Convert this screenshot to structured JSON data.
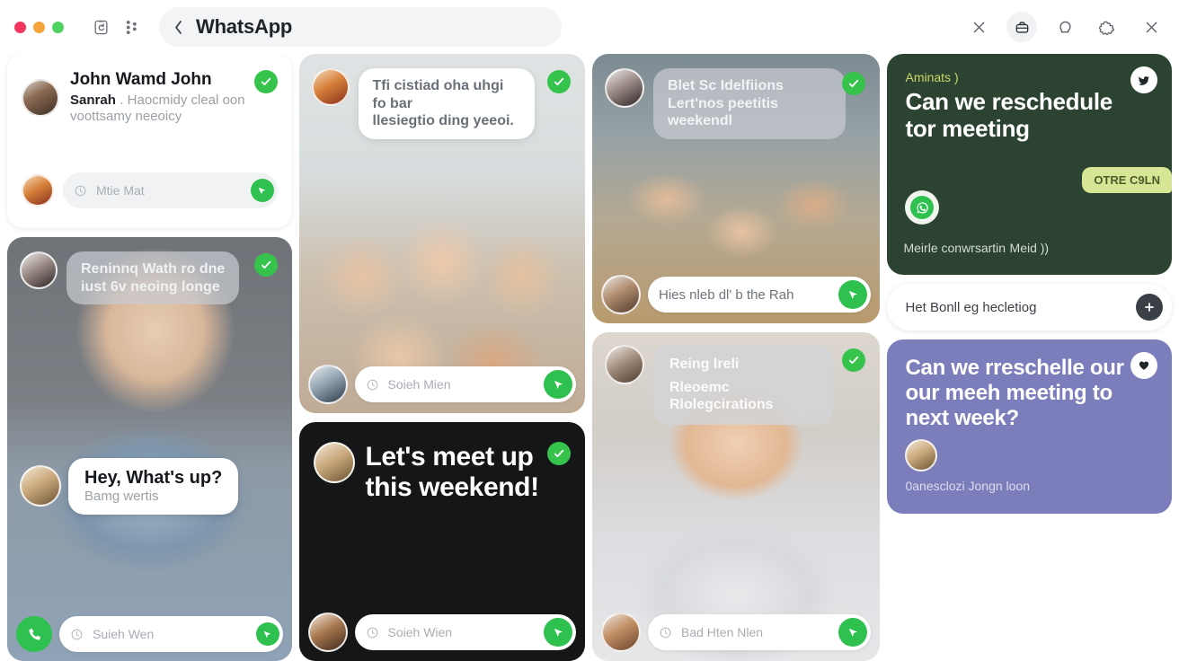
{
  "window": {
    "title": "WhatsApp",
    "back_chevron": "‹",
    "traffic_lights": [
      "close",
      "minimize",
      "maximize"
    ],
    "left_icons": [
      "clipboard-refresh-icon",
      "dots-grid-icon"
    ],
    "right_icons": [
      "close-icon",
      "briefcase-icon",
      "chat-bubble-icon",
      "puzzle-piece-icon",
      "close-icon"
    ],
    "colors": {
      "accent_green": "#2ec14f",
      "check_green": "#35c34c",
      "promo_green": "#2c4331",
      "promo_purple": "#7c7ebc",
      "chip_lime": "#d7e694"
    }
  },
  "column1": {
    "card_contact": {
      "name": "John Wamd John",
      "preview_strong": "Sanrah",
      "preview": ". Haocmidy cleal oon voottsamy neeoicy",
      "badge": "sent-check",
      "composer": {
        "placeholder": "Mtie Mat",
        "attach_icon": "clock-icon",
        "send_icon": "send-icon"
      }
    },
    "card_photo": {
      "bubble_line1": "Reninnq Wath ro dne",
      "bubble_line2": "iust 6v neoing longe",
      "badge": "sent-check",
      "quote_title": "Hey, What's up?",
      "quote_sub": "Bamg wertis",
      "call_icon": "phone-icon",
      "composer": {
        "placeholder": "Suieh Wen",
        "attach_icon": "clock-icon",
        "send_icon": "send-icon"
      }
    }
  },
  "column2": {
    "card_group": {
      "bubble_line1": "Tfi cistiad oha uhgi fo bar",
      "bubble_line2": "llesiegtio ding yeeoi.",
      "badge": "sent-check",
      "composer": {
        "placeholder": "Soieh Mien",
        "attach_icon": "clock-icon",
        "send_icon": "send-icon"
      }
    },
    "card_dark": {
      "headline_line1": "Let's meet up",
      "headline_line2": "this weekend!",
      "badge": "sent-check",
      "composer": {
        "placeholder": "Soieh Wien",
        "attach_icon": "clock-icon",
        "send_icon": "send-icon"
      }
    }
  },
  "column3": {
    "card_friends": {
      "bubble_line1": "Blet Sc Idelfiions",
      "bubble_line2": "Lert'nos peetitis weekendl",
      "badge": "sent-check",
      "composer": {
        "placeholder": "Hies nleb dl' b the Rah",
        "attach_icon": "clock-icon",
        "send_icon": "send-icon"
      }
    },
    "card_woman": {
      "bubble_line1": "Reing lreli",
      "bubble_line2": "Rleoemc Rlolegcirations",
      "badge": "sent-check",
      "composer": {
        "placeholder": "Bad Hten Nlen",
        "attach_icon": "clock-icon",
        "send_icon": "send-icon"
      }
    }
  },
  "column4": {
    "card_green": {
      "eyebrow": "Aminats )",
      "headline_line1": "Can we reschedule",
      "headline_line2": "tor meeting",
      "chip": "OTRE C9LN",
      "footer_text": "Meirle conwrsartin",
      "footer_accent": "Meid ))",
      "badge_icon": "bird-icon",
      "wa_icon": "whatsapp-icon"
    },
    "search_pill": {
      "text": "Het Bonll eg hecletiog",
      "button_icon": "plus-icon"
    },
    "card_purple": {
      "headline_line1": "Can we rreschelle our",
      "headline_line2": "our meeh meeting to",
      "headline_line3": "next week?",
      "sub": "0anesclozi Jongn loon",
      "badge_icon": "heart-icon"
    }
  }
}
